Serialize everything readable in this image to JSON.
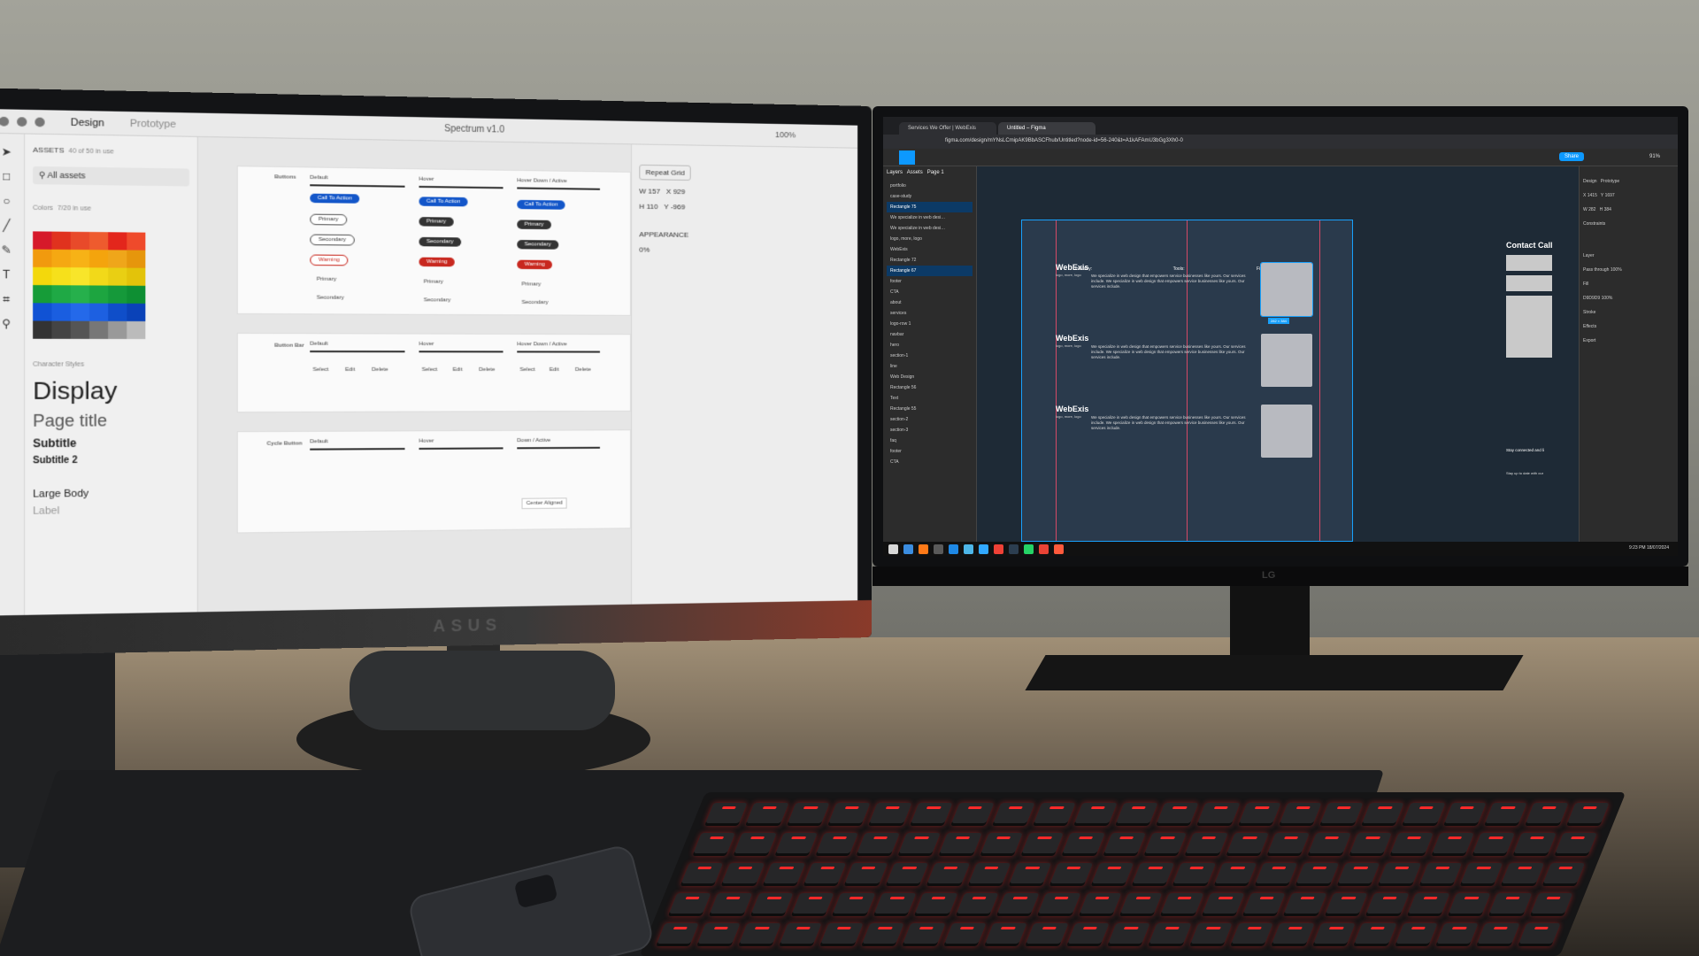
{
  "scene": {
    "wall": "#9b9b93",
    "desk": "#8a7b66",
    "keyboard_glow": "#ff2a2a"
  },
  "monitor_left": {
    "brand": "ASUS",
    "app": {
      "tabs": [
        "Design",
        "Prototype"
      ],
      "doc_title": "Spectrum v1.0",
      "zoom": "100%",
      "assets_label": "ASSETS",
      "assets_count": "40 of 50 in use",
      "search_text": "All assets",
      "colors_label": "Colors",
      "colors_count": "7/20 in use",
      "swatch_colors": [
        "#d6192a",
        "#e0321e",
        "#e84a2a",
        "#ee5b2e",
        "#e3261c",
        "#ef4a2b",
        "#f19a0e",
        "#f5a812",
        "#f7b216",
        "#f4a40d",
        "#efa61a",
        "#e6960c",
        "#f3d80c",
        "#f6e01b",
        "#f8e52a",
        "#f2d919",
        "#e9cf13",
        "#e3c30a",
        "#169c38",
        "#1fa945",
        "#26b04c",
        "#1da540",
        "#15993a",
        "#0e8f33",
        "#1052d4",
        "#1a5ee0",
        "#2469ea",
        "#1d60e1",
        "#0f4ec9",
        "#0a42b8",
        "#333333",
        "#444444",
        "#555555",
        "#777777",
        "#999999",
        "#bbbbbb"
      ],
      "char_styles_label": "Character Styles",
      "char_styles": [
        "Display",
        "Page title",
        "Subtitle",
        "Subtitle 2",
        "Large Body",
        "Label"
      ],
      "board_buttons": {
        "section": "Buttons",
        "headers": [
          "Default",
          "Hover",
          "Hover Down / Active"
        ],
        "labels": [
          "Call To Action",
          "Primary",
          "Secondary",
          "Warning",
          "Primary",
          "Secondary"
        ]
      },
      "board_buttonbar": {
        "section": "Button Bar",
        "headers": [
          "Default",
          "Hover",
          "Hover Down / Active"
        ],
        "items": [
          "Select",
          "Edit",
          "Delete"
        ]
      },
      "board_cycle": {
        "section": "Cycle Button",
        "headers": [
          "Default",
          "Hover",
          "Down / Active"
        ],
        "menu_item": "Center Aligned"
      },
      "panel": {
        "repeat_grid": "Repeat Grid",
        "w": "157",
        "h": "110",
        "x": "929",
        "y": "-969",
        "appearance": "APPEARANCE",
        "opacity": "0%"
      }
    }
  },
  "monitor_right": {
    "brand": "LG",
    "browser": {
      "tabs": [
        "Services We Offer | WebExis",
        "Untitled – Figma"
      ],
      "url": "figma.com/design/mYNsLCmipAK9BbASCFhub/Untitled?node-id=56-240&t=A1kAFAmU3bGg3Xh0-0"
    },
    "figma": {
      "share": "Share",
      "zoom": "91%",
      "panel_tabs": [
        "Layers",
        "Assets"
      ],
      "page": "Page 1",
      "layers": [
        "portfolio",
        "case-study",
        "Rectangle 75",
        "We specialize in web desi…",
        "We specialize in web desi…",
        "logo, more, logo",
        "WebExis",
        "Rectangle 72",
        "Rectangle 67",
        "footer",
        "CTA",
        "about",
        "services",
        "logo-row 1",
        "navbar",
        "hero",
        "section-1",
        "line",
        "Web Design",
        "Rectangle 56",
        "Text",
        "Rectangle 55",
        "section-2",
        "section-3",
        "faq",
        "footer",
        "CTA"
      ],
      "canvas": {
        "search_labels": [
          "Industry:",
          "Tools:",
          "Filter"
        ],
        "cards": [
          {
            "title": "WebExis",
            "sub": "logo, more, logo",
            "text": "We specialize in web design that empowers service businesses like yours. Our services include. We specialize in web design that empowers service businesses like yours. Our services include."
          },
          {
            "title": "WebExis",
            "sub": "logo, more, logo",
            "text": "We specialize in web design that empowers service businesses like yours. Our services include. We specialize in web design that empowers service businesses like yours. Our services include."
          },
          {
            "title": "WebExis",
            "sub": "logo, more, logo",
            "text": "We specialize in web design that empowers service businesses like yours. Our services include. We specialize in web design that empowers service businesses like yours. Our services include."
          }
        ],
        "contact": "Contact Call",
        "stay": "Stay connected and li",
        "stay2": "Stay up to date with our",
        "dims": "282 × 384"
      },
      "props": {
        "tabs": [
          "Design",
          "Prototype"
        ],
        "x": "1415",
        "y": "1697",
        "w": "282",
        "h": "384",
        "constraints": "Constraints",
        "layer": "Layer",
        "blend": "Pass through",
        "opacity": "100%",
        "fill": "Fill",
        "fill_hex": "D9D9D9",
        "fill_op": "100%",
        "stroke": "Stroke",
        "effects": "Effects",
        "export": "Export"
      }
    },
    "taskbar": {
      "time": "9:23 PM",
      "date": "18/07/2024",
      "icon_colors": [
        "#d8d8d8",
        "#3b8de0",
        "#ff7a18",
        "#5a5a5a",
        "#1e88e5",
        "#4db6e8",
        "#31a8ff",
        "#ef4136",
        "#2c3e50",
        "#25d366",
        "#ea4335",
        "#ff5a3c"
      ]
    }
  }
}
